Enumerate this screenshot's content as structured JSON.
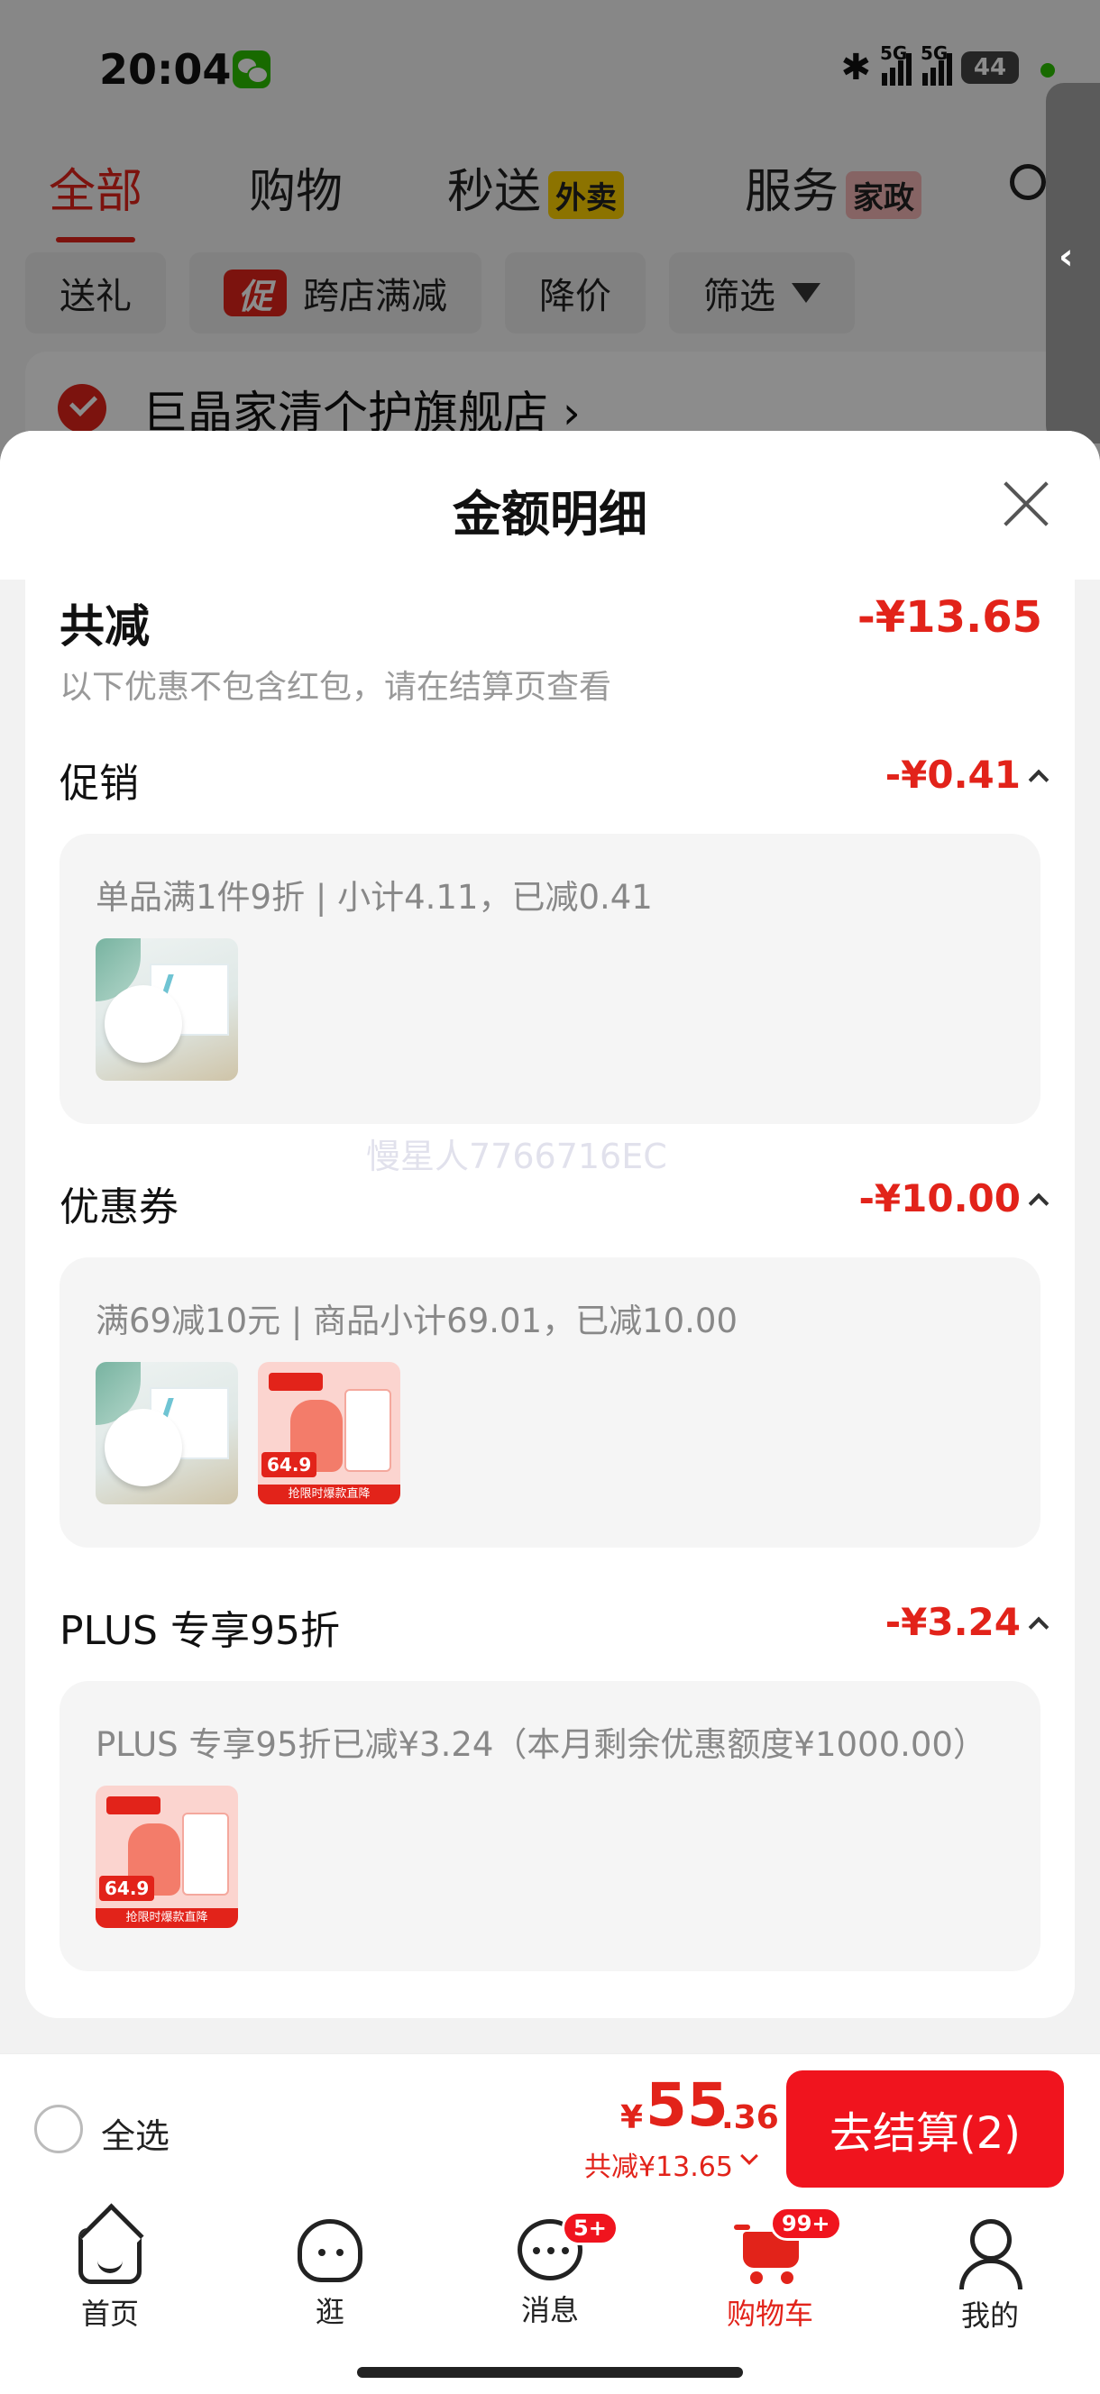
{
  "status_bar": {
    "time": "20:04",
    "network1": "5G",
    "network2": "5G",
    "battery": "44"
  },
  "top_tabs": [
    {
      "label": "全部",
      "active": true
    },
    {
      "label": "购物"
    },
    {
      "label": "秒送",
      "badge": "外卖"
    },
    {
      "label": "服务",
      "badge": "家政"
    }
  ],
  "filters": {
    "gift": "送礼",
    "promo_badge": "促",
    "cross_store": "跨店满减",
    "price_drop": "降价",
    "filter": "筛选"
  },
  "store": {
    "name": "巨晶家清个护旗舰店 ›"
  },
  "sheet": {
    "title": "金额明细",
    "total_label": "共减",
    "total_value": "-¥13.65",
    "total_sub": "以下优惠不包含红包，请在结算页查看",
    "sections": [
      {
        "title": "促销",
        "value": "-¥0.41",
        "detail": "单品满1件9折 | 小计4.11，已减0.41"
      },
      {
        "title": "优惠券",
        "value": "-¥10.00",
        "detail": "满69减10元 | 商品小计69.01，已减10.00"
      },
      {
        "title": "PLUS 专享95折",
        "value": "-¥3.24",
        "detail": "PLUS 专享95折已减¥3.24（本月剩余优惠额度¥1000.00）"
      }
    ],
    "product_price_tag": "64.9",
    "product_strip": "抢限时爆款直降",
    "watermark": "慢星人7766716EC"
  },
  "checkout": {
    "select_all": "全选",
    "yen": "¥",
    "price_int": "55",
    "price_dec": ".36",
    "saved": "共减¥13.65",
    "button": "去结算(2)"
  },
  "tab_bar": [
    {
      "label": "首页",
      "icon": "home-icon"
    },
    {
      "label": "逛",
      "icon": "ghost-icon"
    },
    {
      "label": "消息",
      "icon": "message-icon",
      "badge": "5+"
    },
    {
      "label": "购物车",
      "icon": "cart-icon",
      "badge": "99+",
      "active": true
    },
    {
      "label": "我的",
      "icon": "profile-icon"
    }
  ],
  "colors": {
    "accent": "#e2231a",
    "checkout_button": "#f0141e",
    "muted_text": "#888888"
  }
}
